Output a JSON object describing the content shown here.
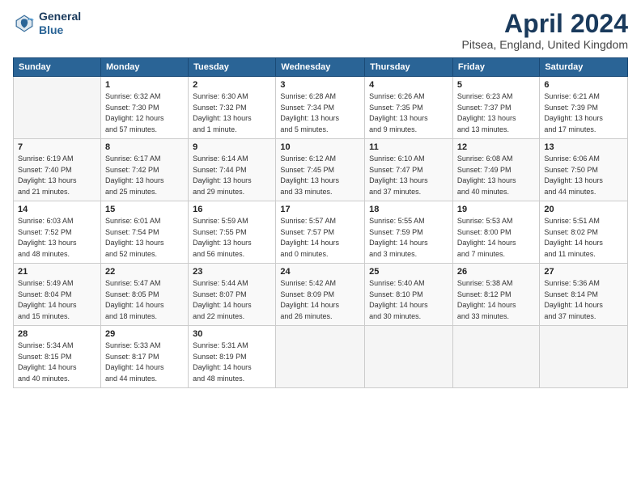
{
  "logo": {
    "line1": "General",
    "line2": "Blue"
  },
  "title": "April 2024",
  "location": "Pitsea, England, United Kingdom",
  "days_header": [
    "Sunday",
    "Monday",
    "Tuesday",
    "Wednesday",
    "Thursday",
    "Friday",
    "Saturday"
  ],
  "weeks": [
    [
      {
        "day": "",
        "info": ""
      },
      {
        "day": "1",
        "info": "Sunrise: 6:32 AM\nSunset: 7:30 PM\nDaylight: 12 hours\nand 57 minutes."
      },
      {
        "day": "2",
        "info": "Sunrise: 6:30 AM\nSunset: 7:32 PM\nDaylight: 13 hours\nand 1 minute."
      },
      {
        "day": "3",
        "info": "Sunrise: 6:28 AM\nSunset: 7:34 PM\nDaylight: 13 hours\nand 5 minutes."
      },
      {
        "day": "4",
        "info": "Sunrise: 6:26 AM\nSunset: 7:35 PM\nDaylight: 13 hours\nand 9 minutes."
      },
      {
        "day": "5",
        "info": "Sunrise: 6:23 AM\nSunset: 7:37 PM\nDaylight: 13 hours\nand 13 minutes."
      },
      {
        "day": "6",
        "info": "Sunrise: 6:21 AM\nSunset: 7:39 PM\nDaylight: 13 hours\nand 17 minutes."
      }
    ],
    [
      {
        "day": "7",
        "info": "Sunrise: 6:19 AM\nSunset: 7:40 PM\nDaylight: 13 hours\nand 21 minutes."
      },
      {
        "day": "8",
        "info": "Sunrise: 6:17 AM\nSunset: 7:42 PM\nDaylight: 13 hours\nand 25 minutes."
      },
      {
        "day": "9",
        "info": "Sunrise: 6:14 AM\nSunset: 7:44 PM\nDaylight: 13 hours\nand 29 minutes."
      },
      {
        "day": "10",
        "info": "Sunrise: 6:12 AM\nSunset: 7:45 PM\nDaylight: 13 hours\nand 33 minutes."
      },
      {
        "day": "11",
        "info": "Sunrise: 6:10 AM\nSunset: 7:47 PM\nDaylight: 13 hours\nand 37 minutes."
      },
      {
        "day": "12",
        "info": "Sunrise: 6:08 AM\nSunset: 7:49 PM\nDaylight: 13 hours\nand 40 minutes."
      },
      {
        "day": "13",
        "info": "Sunrise: 6:06 AM\nSunset: 7:50 PM\nDaylight: 13 hours\nand 44 minutes."
      }
    ],
    [
      {
        "day": "14",
        "info": "Sunrise: 6:03 AM\nSunset: 7:52 PM\nDaylight: 13 hours\nand 48 minutes."
      },
      {
        "day": "15",
        "info": "Sunrise: 6:01 AM\nSunset: 7:54 PM\nDaylight: 13 hours\nand 52 minutes."
      },
      {
        "day": "16",
        "info": "Sunrise: 5:59 AM\nSunset: 7:55 PM\nDaylight: 13 hours\nand 56 minutes."
      },
      {
        "day": "17",
        "info": "Sunrise: 5:57 AM\nSunset: 7:57 PM\nDaylight: 14 hours\nand 0 minutes."
      },
      {
        "day": "18",
        "info": "Sunrise: 5:55 AM\nSunset: 7:59 PM\nDaylight: 14 hours\nand 3 minutes."
      },
      {
        "day": "19",
        "info": "Sunrise: 5:53 AM\nSunset: 8:00 PM\nDaylight: 14 hours\nand 7 minutes."
      },
      {
        "day": "20",
        "info": "Sunrise: 5:51 AM\nSunset: 8:02 PM\nDaylight: 14 hours\nand 11 minutes."
      }
    ],
    [
      {
        "day": "21",
        "info": "Sunrise: 5:49 AM\nSunset: 8:04 PM\nDaylight: 14 hours\nand 15 minutes."
      },
      {
        "day": "22",
        "info": "Sunrise: 5:47 AM\nSunset: 8:05 PM\nDaylight: 14 hours\nand 18 minutes."
      },
      {
        "day": "23",
        "info": "Sunrise: 5:44 AM\nSunset: 8:07 PM\nDaylight: 14 hours\nand 22 minutes."
      },
      {
        "day": "24",
        "info": "Sunrise: 5:42 AM\nSunset: 8:09 PM\nDaylight: 14 hours\nand 26 minutes."
      },
      {
        "day": "25",
        "info": "Sunrise: 5:40 AM\nSunset: 8:10 PM\nDaylight: 14 hours\nand 30 minutes."
      },
      {
        "day": "26",
        "info": "Sunrise: 5:38 AM\nSunset: 8:12 PM\nDaylight: 14 hours\nand 33 minutes."
      },
      {
        "day": "27",
        "info": "Sunrise: 5:36 AM\nSunset: 8:14 PM\nDaylight: 14 hours\nand 37 minutes."
      }
    ],
    [
      {
        "day": "28",
        "info": "Sunrise: 5:34 AM\nSunset: 8:15 PM\nDaylight: 14 hours\nand 40 minutes."
      },
      {
        "day": "29",
        "info": "Sunrise: 5:33 AM\nSunset: 8:17 PM\nDaylight: 14 hours\nand 44 minutes."
      },
      {
        "day": "30",
        "info": "Sunrise: 5:31 AM\nSunset: 8:19 PM\nDaylight: 14 hours\nand 48 minutes."
      },
      {
        "day": "",
        "info": ""
      },
      {
        "day": "",
        "info": ""
      },
      {
        "day": "",
        "info": ""
      },
      {
        "day": "",
        "info": ""
      }
    ]
  ]
}
